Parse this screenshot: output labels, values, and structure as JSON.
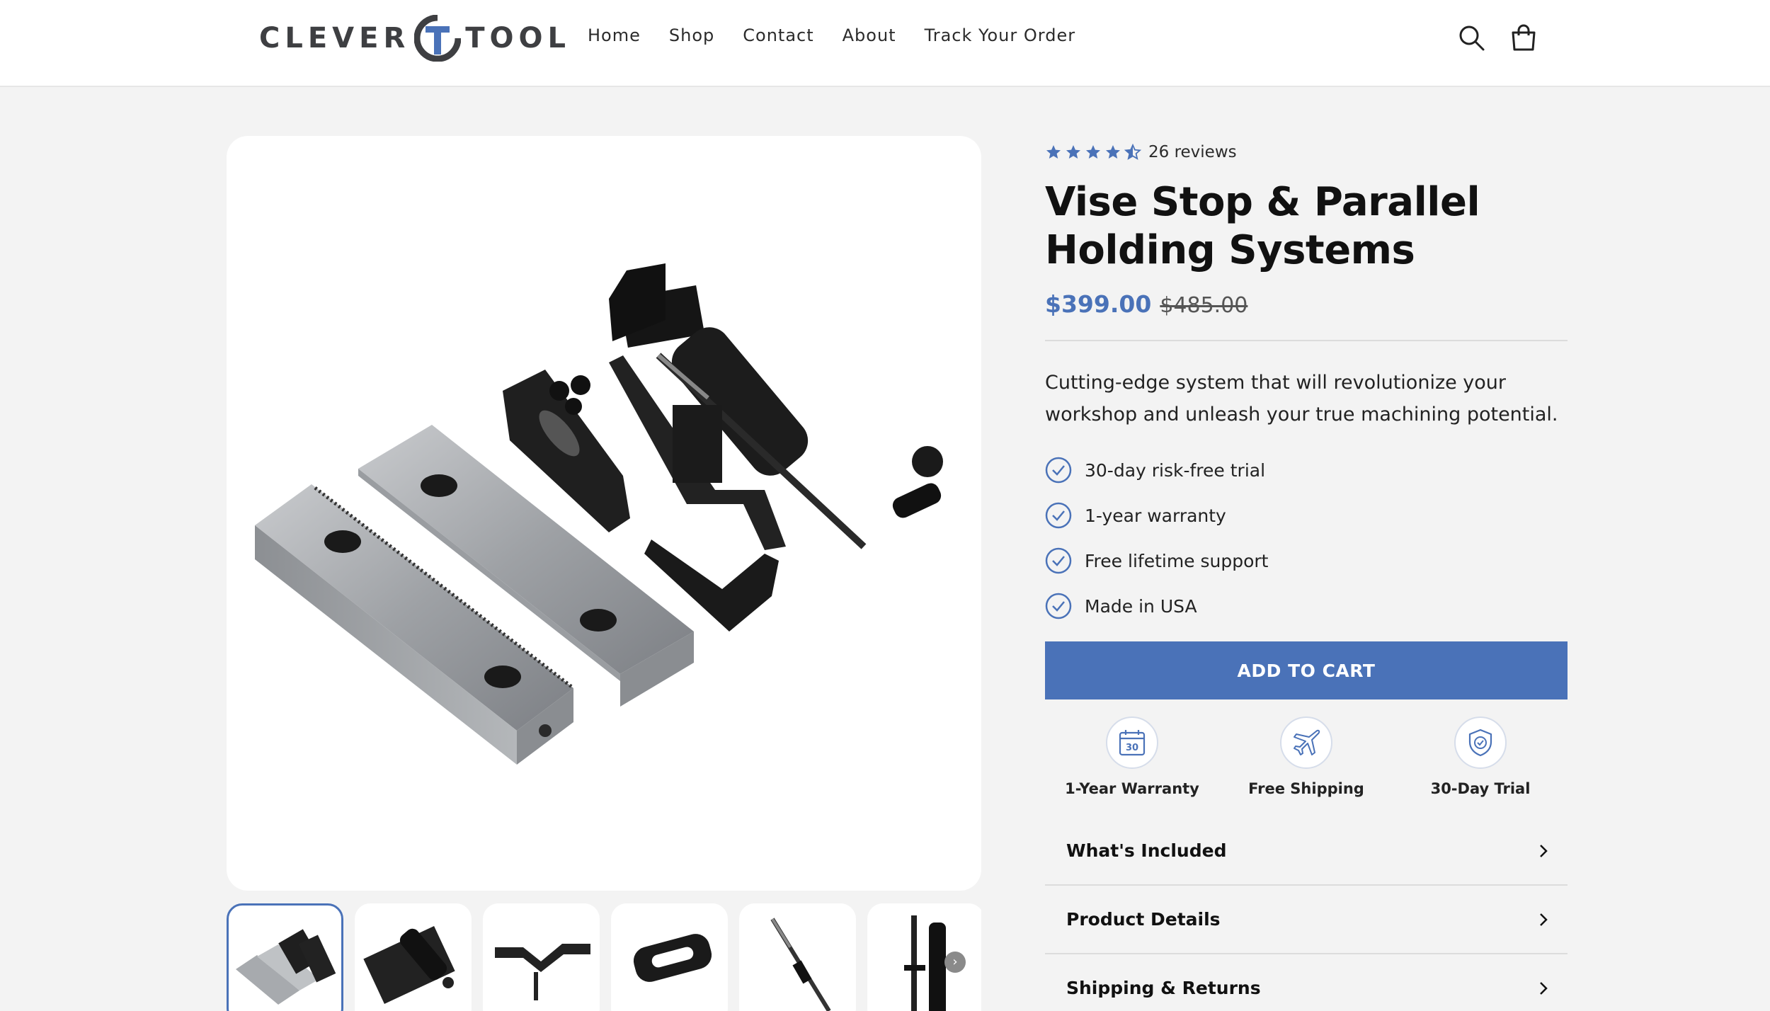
{
  "header": {
    "logo_left": "CLEVER",
    "logo_right": "TOOL",
    "nav": [
      "Home",
      "Shop",
      "Contact",
      "About",
      "Track Your Order"
    ],
    "icons": [
      "search-icon",
      "cart-icon"
    ]
  },
  "product": {
    "rating_value": 4.5,
    "reviews": "26 reviews",
    "title": "Vise Stop & Parallel Holding Systems",
    "price": "$399.00",
    "compare_price": "$485.00",
    "description": "Cutting-edge system that will revolutionize your workshop and unleash your true machining potential.",
    "features": [
      "30-day risk-free trial",
      "1-year warranty",
      "Free lifetime support",
      "Made in USA"
    ],
    "add_to_cart": "ADD TO CART",
    "badges": [
      {
        "icon": "calendar-icon",
        "number": "30",
        "label": "1-Year Warranty"
      },
      {
        "icon": "plane-icon",
        "label": "Free Shipping"
      },
      {
        "icon": "shield-check-icon",
        "label": "30-Day Trial"
      }
    ],
    "accordion": [
      "What's Included",
      "Product Details",
      "Shipping & Returns"
    ]
  },
  "gallery": {
    "thumbnail_count": 6,
    "active_thumbnail": 1,
    "next_icon": "chevron-right-icon"
  },
  "colors": {
    "accent": "#4a72b8",
    "background": "#f3f3f3",
    "logo": "#3e3f42"
  }
}
